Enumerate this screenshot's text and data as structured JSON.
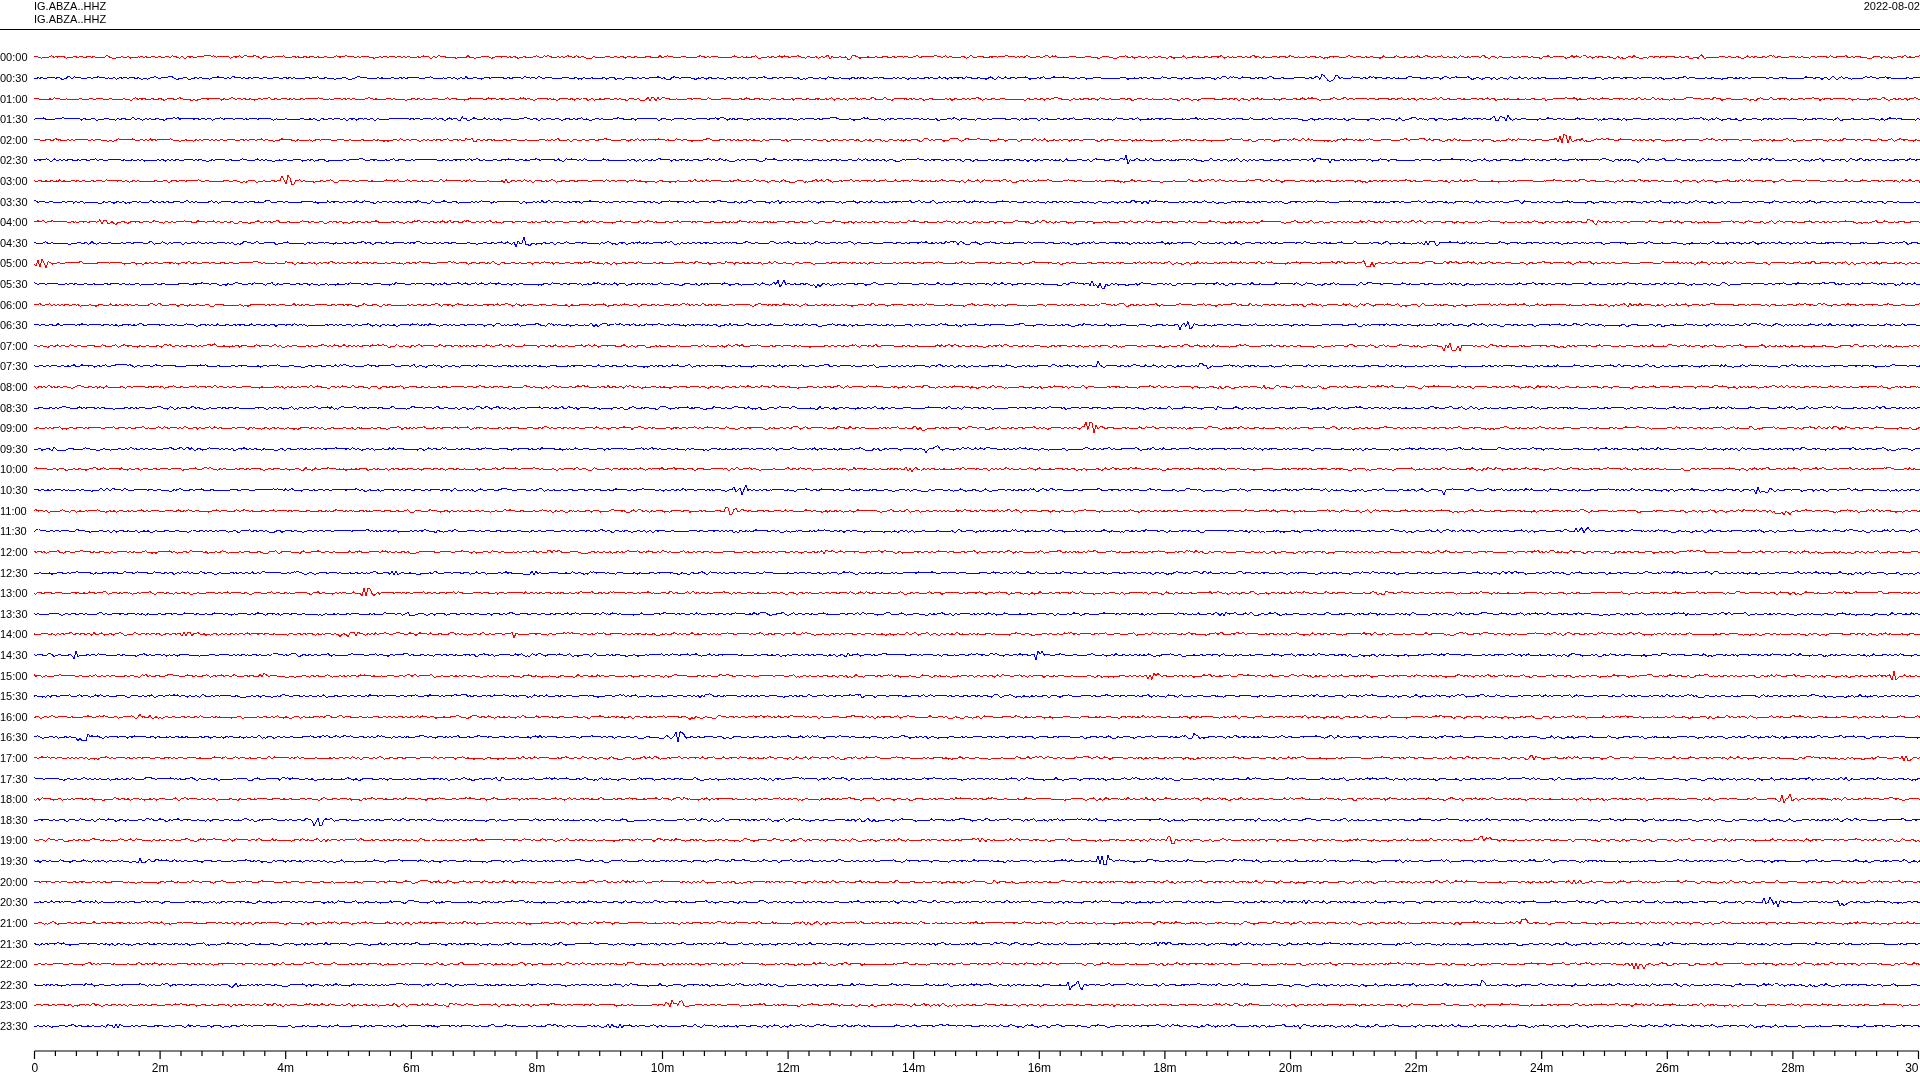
{
  "header": {
    "station_lines": [
      "IG.ABZA..HHZ",
      "IG.ABZA..HHZ"
    ],
    "date": "2022-08-02"
  },
  "traces": [
    {
      "label": "00:00",
      "color": "#ff0000"
    },
    {
      "label": "00:30",
      "color": "#0000ff"
    },
    {
      "label": "01:00",
      "color": "#ff0000"
    },
    {
      "label": "01:30",
      "color": "#0000ff"
    },
    {
      "label": "02:00",
      "color": "#ff0000"
    },
    {
      "label": "02:30",
      "color": "#0000ff"
    },
    {
      "label": "03:00",
      "color": "#ff0000"
    },
    {
      "label": "03:30",
      "color": "#0000ff"
    },
    {
      "label": "04:00",
      "color": "#ff0000"
    },
    {
      "label": "04:30",
      "color": "#0000ff"
    },
    {
      "label": "05:00",
      "color": "#ff0000"
    },
    {
      "label": "05:30",
      "color": "#0000ff"
    },
    {
      "label": "06:00",
      "color": "#ff0000"
    },
    {
      "label": "06:30",
      "color": "#0000ff"
    },
    {
      "label": "07:00",
      "color": "#ff0000"
    },
    {
      "label": "07:30",
      "color": "#0000ff"
    },
    {
      "label": "08:00",
      "color": "#ff0000"
    },
    {
      "label": "08:30",
      "color": "#0000ff"
    },
    {
      "label": "09:00",
      "color": "#ff0000"
    },
    {
      "label": "09:30",
      "color": "#0000ff"
    },
    {
      "label": "10:00",
      "color": "#ff0000"
    },
    {
      "label": "10:30",
      "color": "#0000ff"
    },
    {
      "label": "11:00",
      "color": "#ff0000"
    },
    {
      "label": "11:30",
      "color": "#0000ff"
    },
    {
      "label": "12:00",
      "color": "#ff0000"
    },
    {
      "label": "12:30",
      "color": "#0000ff"
    },
    {
      "label": "13:00",
      "color": "#ff0000"
    },
    {
      "label": "13:30",
      "color": "#0000ff"
    },
    {
      "label": "14:00",
      "color": "#ff0000"
    },
    {
      "label": "14:30",
      "color": "#0000ff"
    },
    {
      "label": "15:00",
      "color": "#ff0000"
    },
    {
      "label": "15:30",
      "color": "#0000ff"
    },
    {
      "label": "16:00",
      "color": "#ff0000"
    },
    {
      "label": "16:30",
      "color": "#0000ff"
    },
    {
      "label": "17:00",
      "color": "#ff0000"
    },
    {
      "label": "17:30",
      "color": "#0000ff"
    },
    {
      "label": "18:00",
      "color": "#ff0000"
    },
    {
      "label": "18:30",
      "color": "#0000ff"
    },
    {
      "label": "19:00",
      "color": "#ff0000"
    },
    {
      "label": "19:30",
      "color": "#0000ff"
    },
    {
      "label": "20:00",
      "color": "#ff0000"
    },
    {
      "label": "20:30",
      "color": "#0000ff"
    },
    {
      "label": "21:00",
      "color": "#ff0000"
    },
    {
      "label": "21:30",
      "color": "#0000ff"
    },
    {
      "label": "22:00",
      "color": "#ff0000"
    },
    {
      "label": "22:30",
      "color": "#0000ff"
    },
    {
      "label": "23:00",
      "color": "#ff0000"
    },
    {
      "label": "23:30",
      "color": "#0000ff"
    }
  ],
  "time_axis": {
    "labels": [
      "0",
      "2m",
      "4m",
      "6m",
      "8m",
      "10m",
      "12m",
      "14m",
      "16m",
      "18m",
      "20m",
      "22m",
      "24m",
      "26m",
      "28m",
      "30"
    ]
  }
}
